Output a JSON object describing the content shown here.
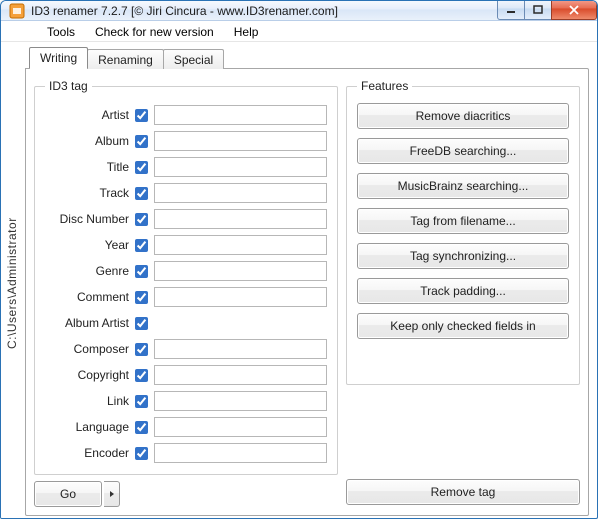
{
  "window": {
    "title": "ID3 renamer 7.2.7 [© Jiri Cincura - www.ID3renamer.com]"
  },
  "menu": {
    "tools": "Tools",
    "check": "Check for new version",
    "help": "Help"
  },
  "sidebar": {
    "path": "C:\\Users\\Administrator"
  },
  "tabs": {
    "writing": "Writing",
    "renaming": "Renaming",
    "special": "Special"
  },
  "groups": {
    "id3tag": "ID3 tag",
    "features": "Features"
  },
  "fields": {
    "artist": {
      "label": "Artist",
      "checked": true,
      "value": ""
    },
    "album": {
      "label": "Album",
      "checked": true,
      "value": ""
    },
    "title": {
      "label": "Title",
      "checked": true,
      "value": ""
    },
    "track": {
      "label": "Track",
      "checked": true,
      "value": ""
    },
    "disc_number": {
      "label": "Disc Number",
      "checked": true,
      "value": ""
    },
    "year": {
      "label": "Year",
      "checked": true,
      "value": ""
    },
    "genre": {
      "label": "Genre",
      "checked": true,
      "value": ""
    },
    "comment": {
      "label": "Comment",
      "checked": true,
      "value": ""
    },
    "album_artist": {
      "label": "Album Artist",
      "checked": true,
      "value": ""
    },
    "composer": {
      "label": "Composer",
      "checked": true,
      "value": ""
    },
    "copyright": {
      "label": "Copyright",
      "checked": true,
      "value": ""
    },
    "link": {
      "label": "Link",
      "checked": true,
      "value": ""
    },
    "language": {
      "label": "Language",
      "checked": true,
      "value": ""
    },
    "encoder": {
      "label": "Encoder",
      "checked": true,
      "value": ""
    }
  },
  "buttons": {
    "go": "Go",
    "remove_tag": "Remove tag"
  },
  "features": {
    "remove_diacritics": "Remove diacritics",
    "freedb": "FreeDB searching...",
    "musicbrainz": "MusicBrainz searching...",
    "tag_from_filename": "Tag from filename...",
    "tag_sync": "Tag synchronizing...",
    "track_padding": "Track padding...",
    "keep_checked": "Keep only checked fields in"
  }
}
